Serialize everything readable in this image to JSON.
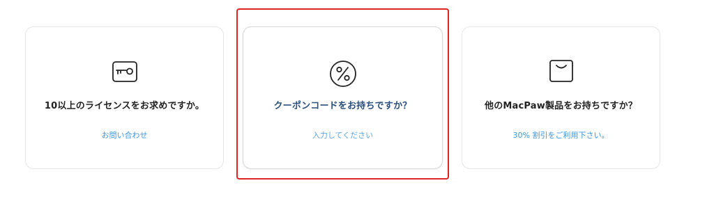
{
  "cards": [
    {
      "title": "10以上のライセンスをお求めですか。",
      "link": "お問い合わせ",
      "icon": "key-icon"
    },
    {
      "title": "クーポンコードをお持ちですか？",
      "link": "入力してください",
      "icon": "percent-icon"
    },
    {
      "title": "他のMacPaw製品をお持ちですか？",
      "link": "30% 割引をご利用下さい。",
      "icon": "shopping-bag-icon"
    }
  ],
  "colors": {
    "title": "#222222",
    "title_accent": "#2a4f7c",
    "link": "#3b97e3",
    "highlight": "#e02424",
    "card_border": "#e6e6e6"
  }
}
